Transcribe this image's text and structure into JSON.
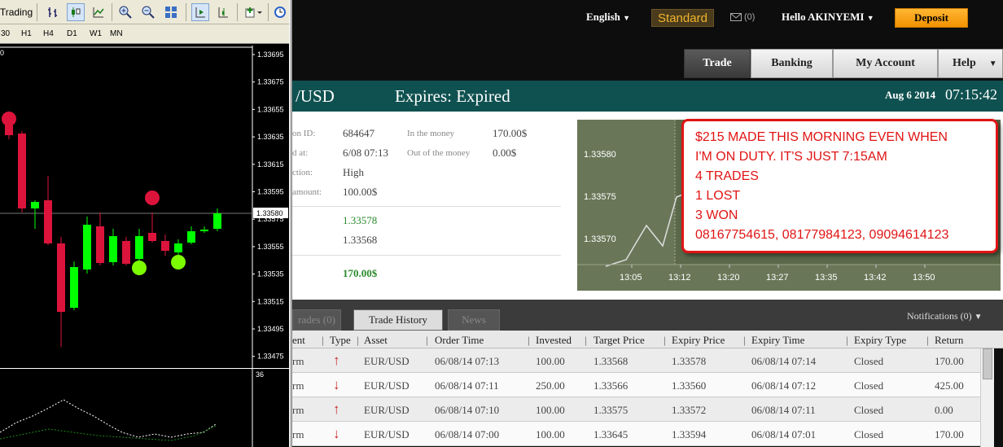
{
  "mt4": {
    "toolbar": {
      "trading_label": "Trading"
    },
    "timeframes": [
      "30",
      "H1",
      "H4",
      "D1",
      "W1",
      "MN"
    ],
    "left_edge_label": "0",
    "price_axis": [
      "1.33695",
      "1.33675",
      "1.33655",
      "1.33635",
      "1.33615",
      "1.33595",
      "1.33575",
      "1.33555",
      "1.33535",
      "1.33515",
      "1.33495",
      "1.33475"
    ],
    "current_price": "1.33580",
    "osc_axis_label": "36",
    "colors": {
      "bull": "#00ff00",
      "bear": "#dc143c",
      "marker_up": "#7cfc00",
      "marker_down": "#dc143c"
    }
  },
  "header": {
    "language": "English",
    "account_type": "Standard",
    "messages": "(0)",
    "greeting": "Hello AKINYEMI",
    "deposit_label": "Deposit"
  },
  "nav": {
    "tabs": [
      {
        "label": "Trade",
        "active": true
      },
      {
        "label": "Banking",
        "active": false
      },
      {
        "label": "My Account",
        "active": false
      },
      {
        "label": "Help",
        "active": false
      }
    ]
  },
  "asset_bar": {
    "asset": "/USD",
    "expires": "Expires:  Expired",
    "date": "Aug 6 2014",
    "time": "07:15:42"
  },
  "details": {
    "option_id_label": "on ID:",
    "option_id": "684647",
    "placed_label": "d at:",
    "placed": "6/08 07:13",
    "direction_label": "ction:",
    "direction": "High",
    "amount_label": "amount:",
    "amount": "100.00$",
    "in_money_label": "In the money",
    "in_money": "170.00$",
    "out_money_label": "Out of the money",
    "out_money": "0.00$",
    "expiry_rate": "1.33578",
    "target_rate": "1.33568",
    "return": "170.00$"
  },
  "mini_chart": {
    "y_labels": [
      "1.33580",
      "1.33575",
      "1.33570"
    ],
    "x_labels": [
      "13:05",
      "13:12",
      "13:20",
      "13:27",
      "13:35",
      "13:42",
      "13:50"
    ]
  },
  "history_tabs": {
    "open_trades": "rades (0)",
    "trade_history": "Trade History",
    "news": "News",
    "notifications": "Notifications (0)"
  },
  "table": {
    "headers": [
      "ent",
      "Type",
      "Asset",
      "Order Time",
      "Invested",
      "Target Price",
      "Expiry Price",
      "Expiry Time",
      "Expiry Type",
      "Return"
    ],
    "rows": [
      {
        "instrument": "rm",
        "dir": "up",
        "arrow": "↑",
        "asset": "EUR/USD",
        "order_time": "06/08/14 07:13",
        "invested": "100.00",
        "target": "1.33568",
        "expiry_price": "1.33578",
        "expiry_time": "06/08/14 07:14",
        "expiry_type": "Closed",
        "ret": "170.00"
      },
      {
        "instrument": "rm",
        "dir": "down",
        "arrow": "↓",
        "asset": "EUR/USD",
        "order_time": "06/08/14 07:11",
        "invested": "250.00",
        "target": "1.33566",
        "expiry_price": "1.33560",
        "expiry_time": "06/08/14 07:12",
        "expiry_type": "Closed",
        "ret": "425.00"
      },
      {
        "instrument": "rm",
        "dir": "up",
        "arrow": "↑",
        "asset": "EUR/USD",
        "order_time": "06/08/14 07:10",
        "invested": "100.00",
        "target": "1.33575",
        "expiry_price": "1.33572",
        "expiry_time": "06/08/14 07:11",
        "expiry_type": "Closed",
        "ret": "0.00"
      },
      {
        "instrument": "rm",
        "dir": "down",
        "arrow": "↓",
        "asset": "EUR/USD",
        "order_time": "06/08/14 07:00",
        "invested": "100.00",
        "target": "1.33645",
        "expiry_price": "1.33594",
        "expiry_time": "06/08/14 07:01",
        "expiry_type": "Closed",
        "ret": "170.00"
      }
    ]
  },
  "note": {
    "lines": [
      "$215 MADE THIS MORNING EVEN WHEN",
      "I'M ON DUTY. IT'S JUST 7:15AM",
      "4 TRADES",
      "1 LOST",
      "3 WON",
      "08167754615, 08177984123, 09094614123"
    ]
  }
}
